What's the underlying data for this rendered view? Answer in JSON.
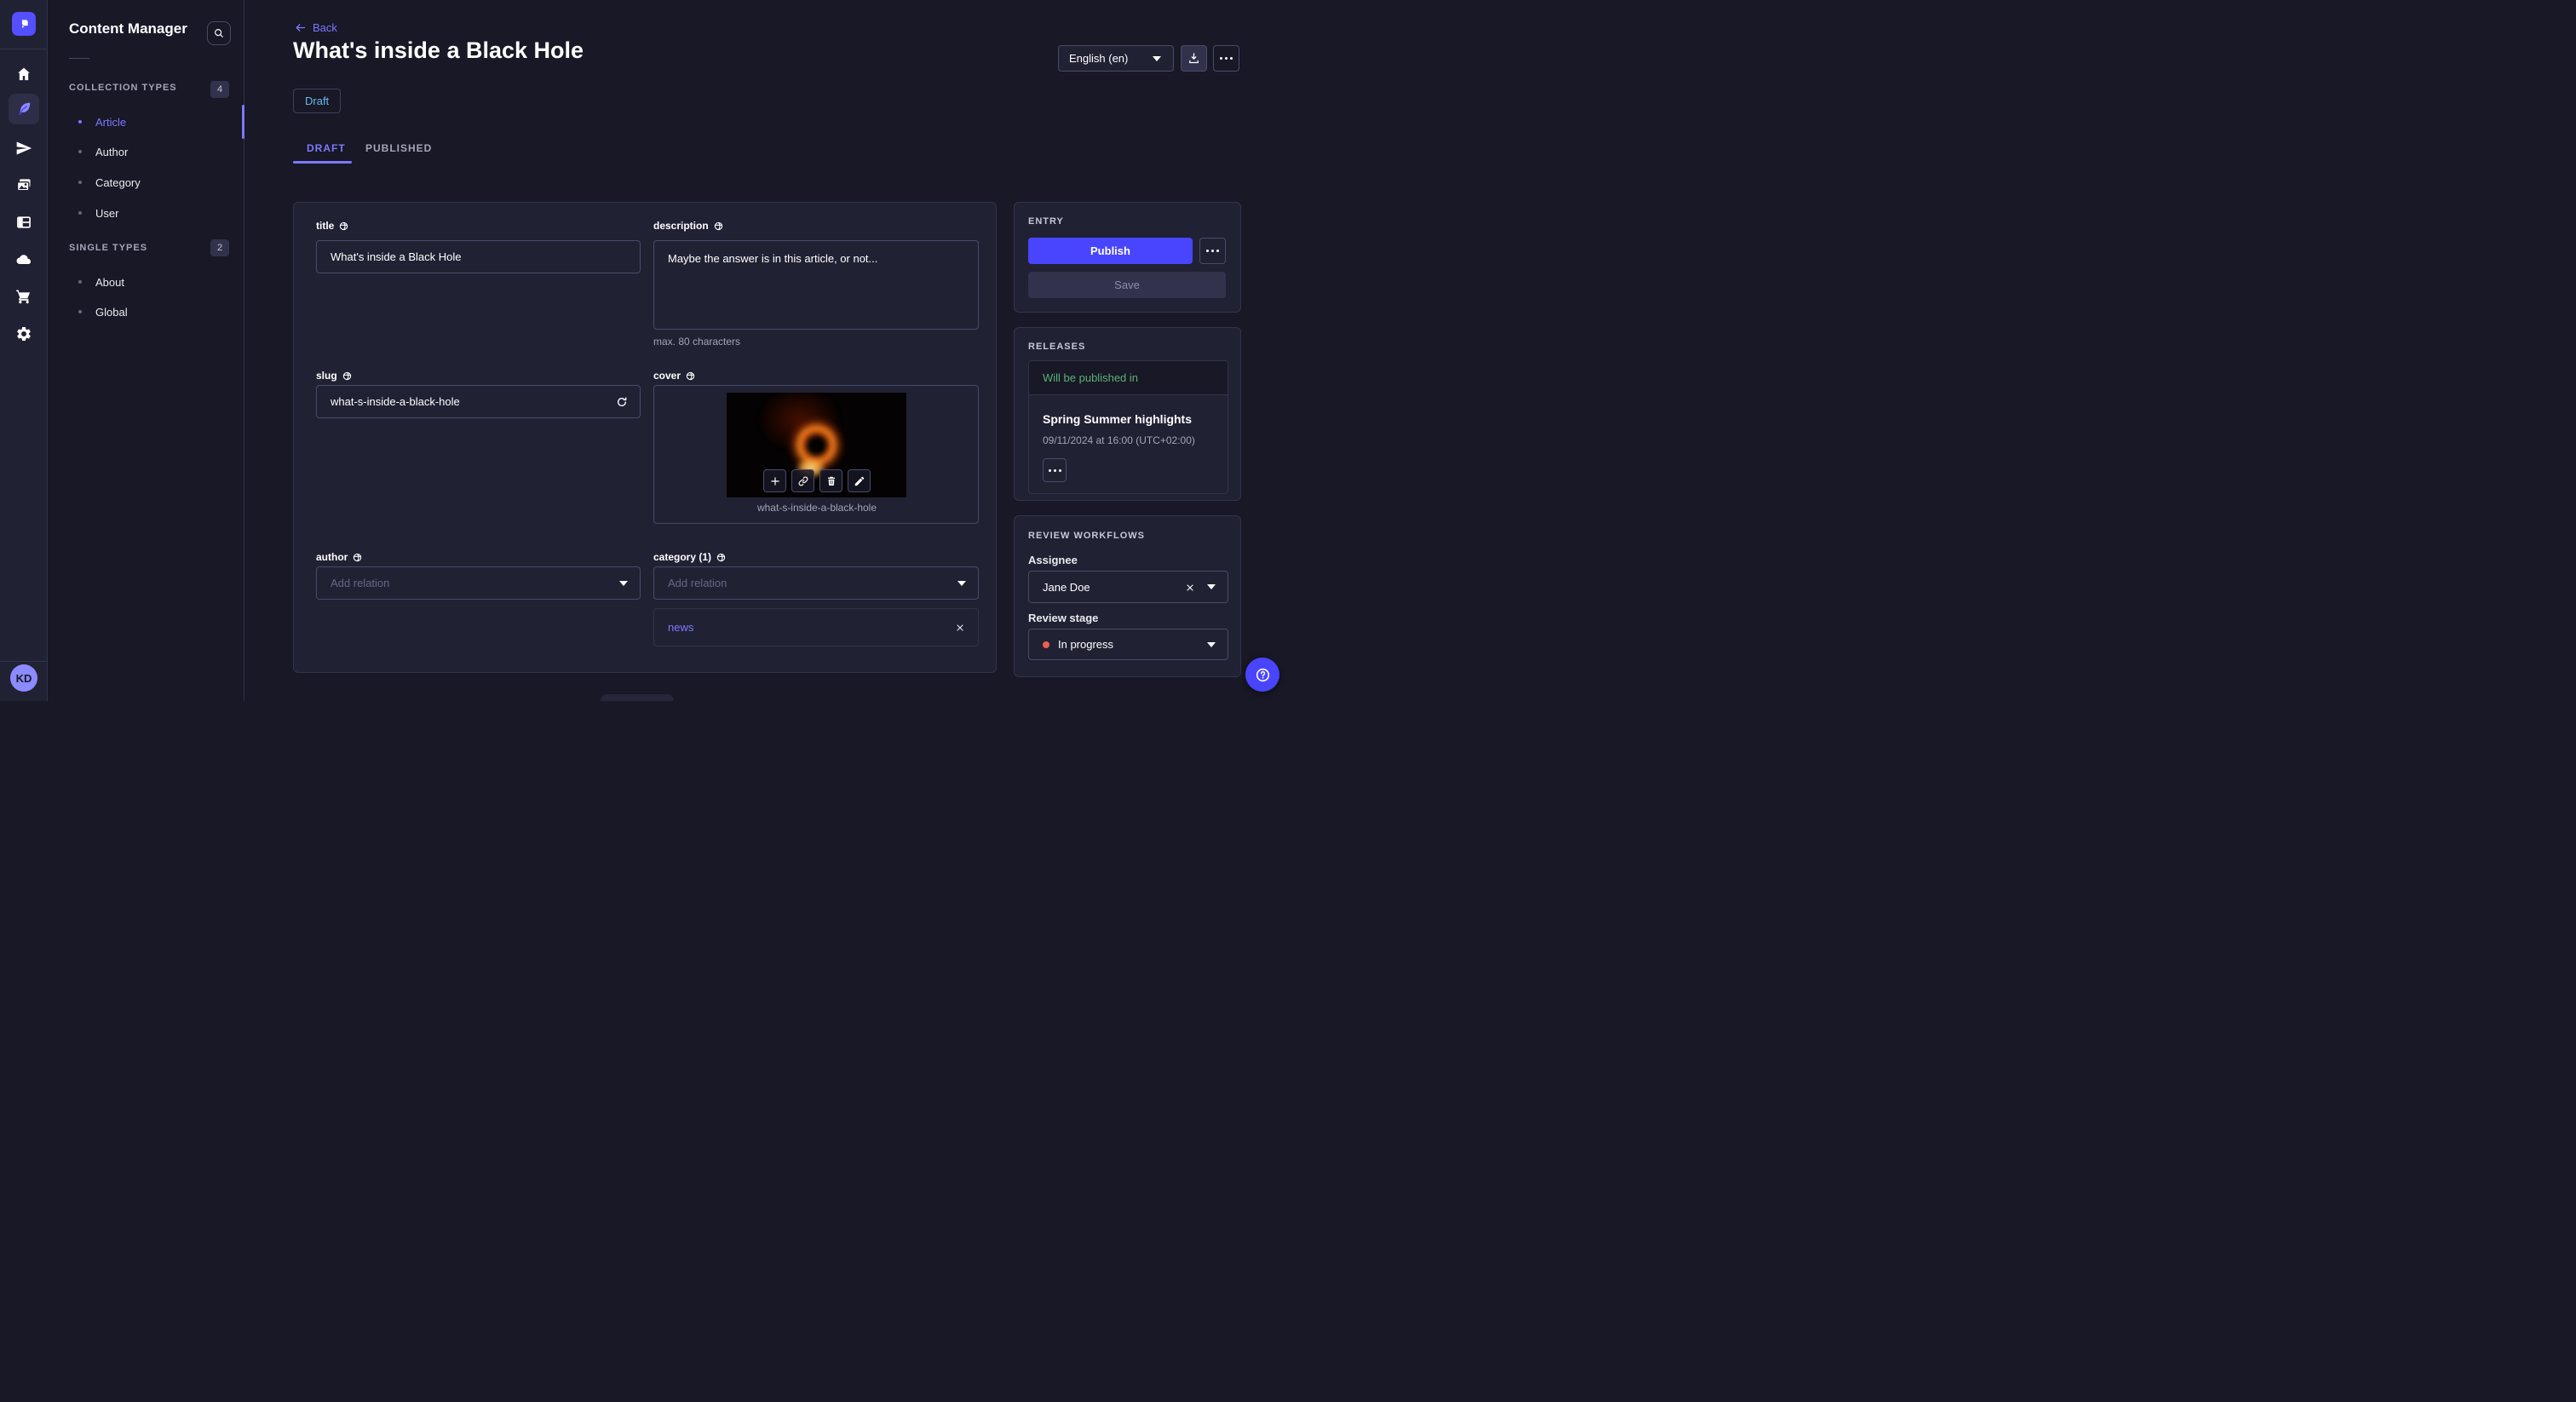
{
  "colors": {
    "accent": "#4945ff",
    "link": "#7b79ff",
    "success": "#5cb176",
    "danger": "#ee5e52",
    "draft_status": "#66b7f1",
    "page_bg": "#181826",
    "panel_bg": "#212134"
  },
  "icons": {
    "strapi-logo": "▣",
    "search": "⌕",
    "home": "⌂",
    "content": "🪶",
    "releases": "➤",
    "media-library": "🖼",
    "content-type-builder": "▥",
    "cloud": "☁",
    "marketplace": "🛒",
    "settings": "⚙",
    "globe": "🌐",
    "refresh": "⟳",
    "add": "+",
    "link": "🔗",
    "delete": "🗑",
    "edit": "✎",
    "more": "⋯",
    "download": "⭳",
    "close": "✕",
    "caret": "▾",
    "back": "←",
    "help": "?"
  },
  "rail": {
    "avatar_initials": "KD"
  },
  "subnav": {
    "title": "Content Manager",
    "sections": [
      {
        "label": "COLLECTION TYPES",
        "count": "4",
        "items": [
          {
            "label": "Article"
          },
          {
            "label": "Author"
          },
          {
            "label": "Category"
          },
          {
            "label": "User"
          }
        ]
      },
      {
        "label": "SINGLE TYPES",
        "count": "2",
        "items": [
          {
            "label": "About"
          },
          {
            "label": "Global"
          }
        ]
      }
    ]
  },
  "header": {
    "back_label": "Back",
    "title": "What's inside a Black Hole",
    "status_badge": "Draft",
    "language": "English (en)",
    "tabs": [
      {
        "label": "DRAFT"
      },
      {
        "label": "PUBLISHED"
      }
    ]
  },
  "form": {
    "title": {
      "label": "title",
      "value": "What's inside a Black Hole"
    },
    "description": {
      "label": "description",
      "value": "Maybe the answer is in this article, or not...",
      "hint": "max. 80 characters"
    },
    "slug": {
      "label": "slug",
      "value": "what-s-inside-a-black-hole"
    },
    "cover": {
      "label": "cover",
      "caption": "what-s-inside-a-black-hole"
    },
    "author": {
      "label": "author",
      "placeholder": "Add relation"
    },
    "category": {
      "label": "category (1)",
      "placeholder": "Add relation",
      "selected": "news"
    }
  },
  "entry_panel": {
    "heading": "ENTRY",
    "publish_label": "Publish",
    "save_label": "Save"
  },
  "releases_panel": {
    "heading": "RELEASES",
    "status": "Will be published in",
    "release_name": "Spring Summer highlights",
    "release_date": "09/11/2024 at 16:00 (UTC+02:00)"
  },
  "review_panel": {
    "heading": "REVIEW WORKFLOWS",
    "assignee_label": "Assignee",
    "assignee_value": "Jane Doe",
    "stage_label": "Review stage",
    "stage_value": "In progress"
  }
}
